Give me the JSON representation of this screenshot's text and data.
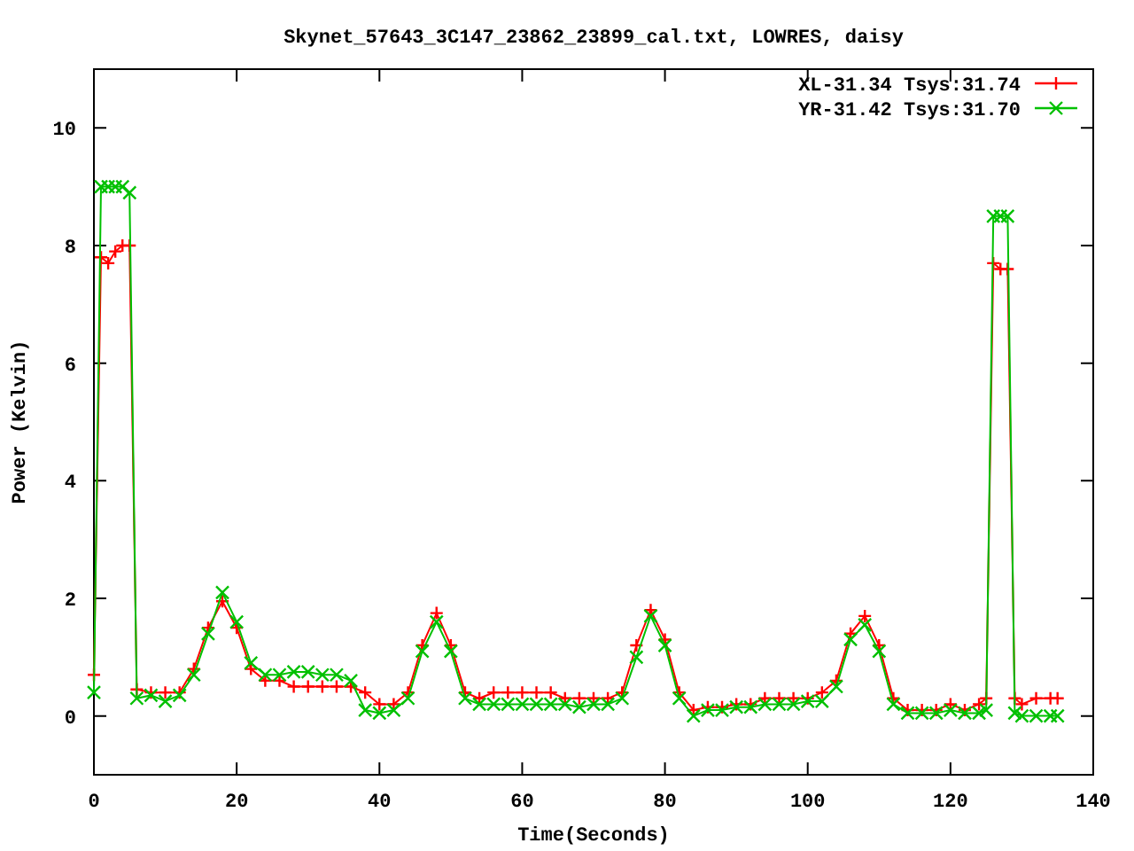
{
  "chart_data": {
    "type": "line",
    "title": "Skynet_57643_3C147_23862_23899_cal.txt, LOWRES, daisy",
    "xlabel": "Time(Seconds)",
    "ylabel": "Power (Kelvin)",
    "x": [
      0,
      1,
      2,
      3,
      4,
      5,
      6,
      8,
      10,
      12,
      14,
      16,
      18,
      20,
      22,
      24,
      26,
      28,
      30,
      32,
      34,
      36,
      38,
      40,
      42,
      44,
      46,
      48,
      50,
      52,
      54,
      56,
      58,
      60,
      62,
      64,
      66,
      68,
      70,
      72,
      74,
      76,
      78,
      80,
      82,
      84,
      86,
      88,
      90,
      92,
      94,
      96,
      98,
      100,
      102,
      104,
      106,
      108,
      110,
      112,
      114,
      116,
      118,
      120,
      122,
      124,
      125,
      126,
      127,
      128,
      129,
      130,
      132,
      134,
      135
    ],
    "series": [
      {
        "name": "XL-31.34 Tsys:31.74",
        "color": "#ff0000",
        "marker": "plus",
        "values": [
          0.7,
          7.8,
          7.7,
          7.9,
          8.0,
          8.0,
          0.45,
          0.4,
          0.4,
          0.4,
          0.8,
          1.5,
          1.95,
          1.5,
          0.8,
          0.6,
          0.6,
          0.5,
          0.5,
          0.5,
          0.5,
          0.5,
          0.4,
          0.2,
          0.2,
          0.4,
          1.2,
          1.75,
          1.2,
          0.4,
          0.3,
          0.4,
          0.4,
          0.4,
          0.4,
          0.4,
          0.3,
          0.3,
          0.3,
          0.3,
          0.4,
          1.2,
          1.8,
          1.3,
          0.4,
          0.1,
          0.15,
          0.15,
          0.2,
          0.2,
          0.3,
          0.3,
          0.3,
          0.3,
          0.4,
          0.6,
          1.4,
          1.7,
          1.2,
          0.3,
          0.1,
          0.1,
          0.1,
          0.2,
          0.1,
          0.2,
          0.3,
          7.7,
          7.6,
          7.6,
          0.3,
          0.2,
          0.3,
          0.3,
          0.3
        ]
      },
      {
        "name": "YR-31.42 Tsys:31.70",
        "color": "#00c000",
        "marker": "cross",
        "values": [
          0.4,
          9.0,
          9.0,
          9.0,
          9.0,
          8.9,
          0.3,
          0.35,
          0.25,
          0.35,
          0.7,
          1.4,
          2.1,
          1.6,
          0.9,
          0.7,
          0.7,
          0.75,
          0.75,
          0.7,
          0.7,
          0.6,
          0.1,
          0.05,
          0.1,
          0.3,
          1.1,
          1.6,
          1.1,
          0.3,
          0.2,
          0.2,
          0.2,
          0.2,
          0.2,
          0.2,
          0.2,
          0.15,
          0.2,
          0.2,
          0.3,
          1.0,
          1.7,
          1.2,
          0.3,
          0.0,
          0.1,
          0.1,
          0.15,
          0.15,
          0.2,
          0.2,
          0.2,
          0.25,
          0.25,
          0.5,
          1.3,
          1.55,
          1.1,
          0.2,
          0.05,
          0.05,
          0.05,
          0.1,
          0.05,
          0.05,
          0.1,
          8.5,
          8.5,
          8.5,
          0.05,
          0.0,
          0.0,
          0.0,
          0.0
        ]
      }
    ],
    "legend": true,
    "xlim": [
      0,
      140
    ],
    "ylim": [
      -1,
      11
    ],
    "xticks": [
      0,
      20,
      40,
      60,
      80,
      100,
      120,
      140
    ],
    "yticks": [
      0,
      2,
      4,
      6,
      8,
      10
    ]
  }
}
